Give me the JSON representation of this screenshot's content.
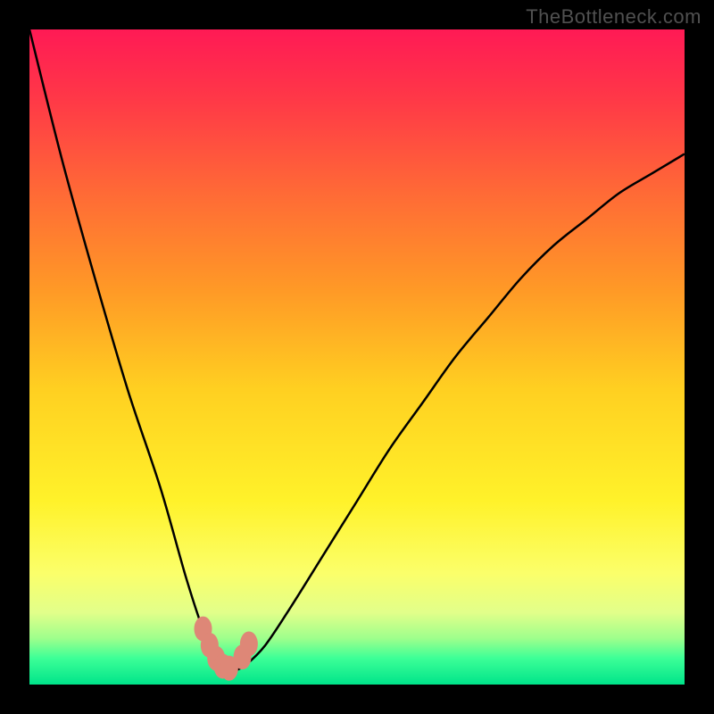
{
  "watermark": "TheBottleneck.com",
  "colors": {
    "frame_bg": "#000000",
    "gradient_stops": [
      {
        "offset": 0.0,
        "color": "#ff1a55"
      },
      {
        "offset": 0.1,
        "color": "#ff3648"
      },
      {
        "offset": 0.25,
        "color": "#ff6a36"
      },
      {
        "offset": 0.4,
        "color": "#ff9a26"
      },
      {
        "offset": 0.55,
        "color": "#ffd021"
      },
      {
        "offset": 0.72,
        "color": "#fff22a"
      },
      {
        "offset": 0.83,
        "color": "#fbff6a"
      },
      {
        "offset": 0.89,
        "color": "#e2ff8a"
      },
      {
        "offset": 0.93,
        "color": "#9dff8c"
      },
      {
        "offset": 0.96,
        "color": "#3cff97"
      },
      {
        "offset": 1.0,
        "color": "#00e48a"
      }
    ],
    "curve_stroke": "#000000",
    "marker_fill": "#de8777"
  },
  "chart_data": {
    "type": "line",
    "title": "",
    "xlabel": "",
    "ylabel": "",
    "xlim": [
      0,
      100
    ],
    "ylim": [
      0,
      100
    ],
    "series": [
      {
        "name": "bottleneck-curve",
        "x": [
          0,
          5,
          10,
          15,
          20,
          24,
          27,
          29,
          30,
          31,
          33,
          36,
          40,
          45,
          50,
          55,
          60,
          65,
          70,
          75,
          80,
          85,
          90,
          95,
          100
        ],
        "values": [
          100,
          80,
          62,
          45,
          30,
          16,
          7,
          3,
          2,
          2,
          3,
          6,
          12,
          20,
          28,
          36,
          43,
          50,
          56,
          62,
          67,
          71,
          75,
          78,
          81
        ]
      }
    ],
    "markers": {
      "name": "highlight-near-minimum",
      "x": [
        26.5,
        27.5,
        28.5,
        29.5,
        30.5,
        32.5,
        33.5
      ],
      "values": [
        8.5,
        6.0,
        4.0,
        2.8,
        2.5,
        4.2,
        6.2
      ]
    },
    "annotations": []
  }
}
